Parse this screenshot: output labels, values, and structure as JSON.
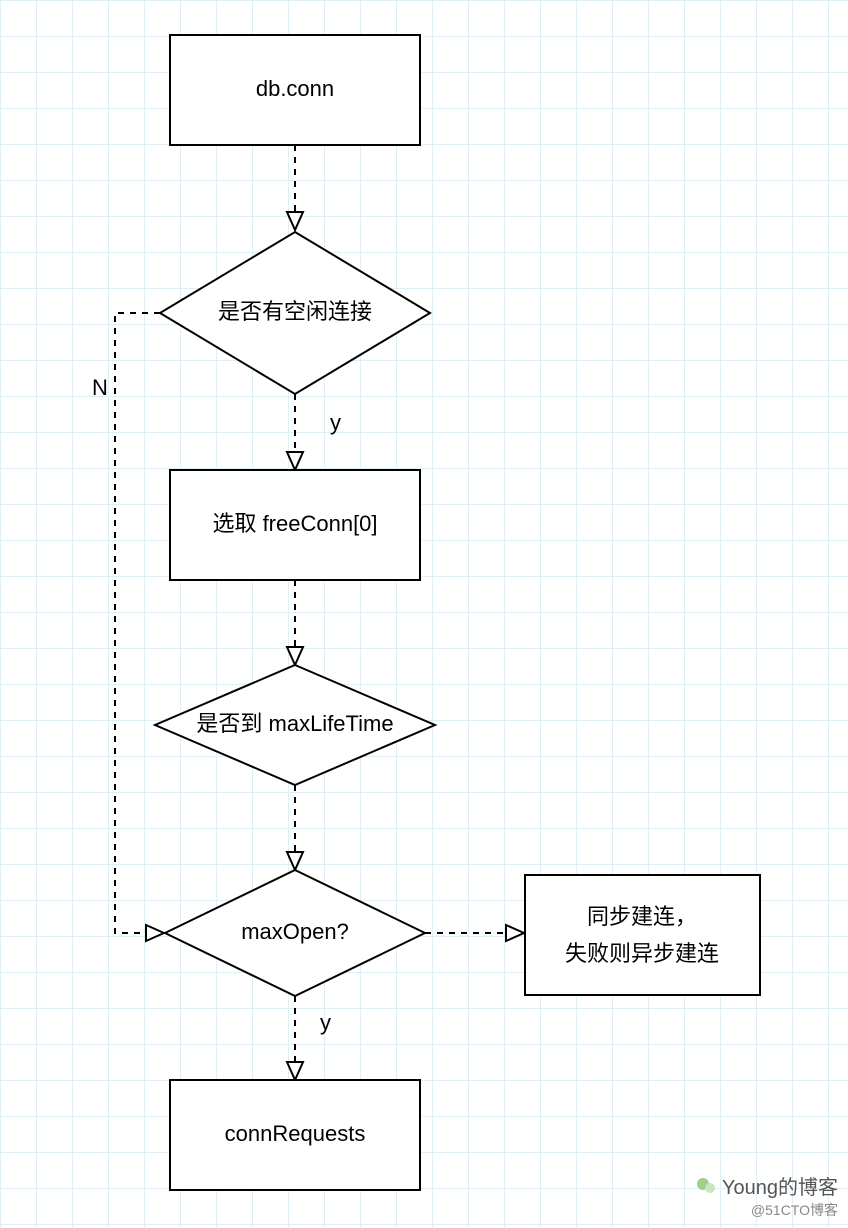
{
  "chart_data": {
    "type": "flowchart",
    "nodes": [
      {
        "id": "start",
        "shape": "rect",
        "label": "db.conn"
      },
      {
        "id": "hasIdle",
        "shape": "diamond",
        "label": "是否有空闲连接"
      },
      {
        "id": "pick",
        "shape": "rect",
        "label": "选取 freeConn[0]"
      },
      {
        "id": "lifetime",
        "shape": "diamond",
        "label": "是否到 maxLifeTime"
      },
      {
        "id": "maxopen",
        "shape": "diamond",
        "label": "maxOpen?"
      },
      {
        "id": "sync",
        "shape": "rect",
        "label_lines": [
          "同步建连，",
          "失败则异步建连"
        ]
      },
      {
        "id": "connreq",
        "shape": "rect",
        "label": "connRequests"
      }
    ],
    "edges": [
      {
        "from": "start",
        "to": "hasIdle",
        "label": ""
      },
      {
        "from": "hasIdle",
        "to": "pick",
        "label": "y"
      },
      {
        "from": "hasIdle",
        "to": "maxopen",
        "label": "N",
        "via": "left"
      },
      {
        "from": "pick",
        "to": "lifetime",
        "label": ""
      },
      {
        "from": "lifetime",
        "to": "maxopen",
        "label": ""
      },
      {
        "from": "maxopen",
        "to": "sync",
        "label": ""
      },
      {
        "from": "maxopen",
        "to": "connreq",
        "label": "y"
      }
    ]
  },
  "watermark": {
    "line1": "Young的博客",
    "line2": "@51CTO博客"
  }
}
